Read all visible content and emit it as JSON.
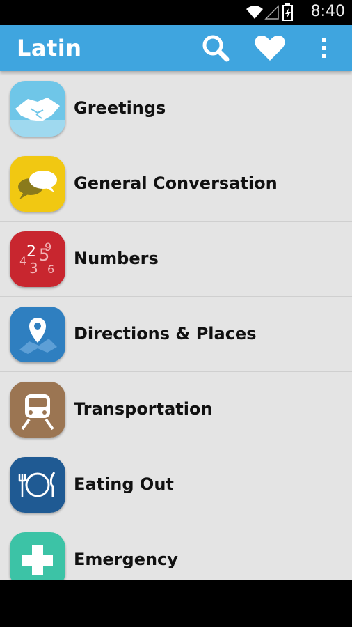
{
  "status_bar": {
    "time": "8:40"
  },
  "app_bar": {
    "title": "Latin",
    "actions": [
      "search-icon",
      "heart-icon",
      "overflow-menu-icon"
    ]
  },
  "categories": [
    {
      "label": "Greetings",
      "icon": "handshake-icon",
      "color": "#6fc6e8"
    },
    {
      "label": "General Conversation",
      "icon": "speech-bubbles-icon",
      "color": "#f1c812"
    },
    {
      "label": "Numbers",
      "icon": "numbers-icon",
      "color": "#c8262f"
    },
    {
      "label": "Directions & Places",
      "icon": "map-pin-icon",
      "color": "#2f7fc0"
    },
    {
      "label": "Transportation",
      "icon": "train-icon",
      "color": "#9b7552"
    },
    {
      "label": "Eating Out",
      "icon": "plate-cutlery-icon",
      "color": "#1f5a93"
    },
    {
      "label": "Emergency",
      "icon": "medical-cross-icon",
      "color": "#3cc3a6"
    }
  ],
  "colors": {
    "app_bar": "#3fa5df",
    "list_background": "#e4e4e4"
  }
}
